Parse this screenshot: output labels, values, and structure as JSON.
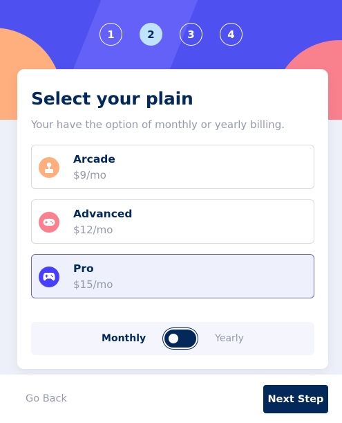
{
  "steps": [
    "1",
    "2",
    "3",
    "4"
  ],
  "active_step": "2",
  "card": {
    "title": "Select your plain",
    "subtitle": "Your have the option of monthly or yearly billing."
  },
  "plans": [
    {
      "name": "Arcade",
      "price": "$9/mo",
      "icon": "arcade-icon",
      "color": "#ffaf7e",
      "selected": false
    },
    {
      "name": "Advanced",
      "price": "$12/mo",
      "icon": "gamepad-icon",
      "color": "#f9818e",
      "selected": false
    },
    {
      "name": "Pro",
      "price": "$15/mo",
      "icon": "controller-icon",
      "color": "#483eff",
      "selected": true
    }
  ],
  "billing": {
    "monthly_label": "Monthly",
    "yearly_label": "Yearly",
    "selected": "Monthly"
  },
  "footer": {
    "back_label": "Go Back",
    "next_label": "Next Step"
  },
  "colors": {
    "header": "#4f50f0",
    "primary_dark": "#02295a",
    "muted": "#9699ab",
    "accent_light": "#bfe2fd"
  }
}
